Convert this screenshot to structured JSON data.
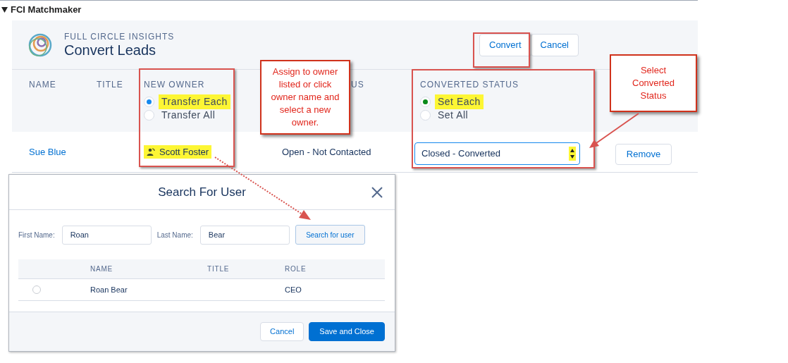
{
  "section": {
    "title": "FCI Matchmaker",
    "expanded": true
  },
  "app": {
    "brand": "FULL CIRCLE INSIGHTS",
    "title": "Convert Leads",
    "buttons": [
      {
        "label": "Convert",
        "kind": "neutral"
      },
      {
        "label": "Cancel",
        "kind": "neutral"
      }
    ]
  },
  "columns": [
    {
      "label": "NAME"
    },
    {
      "label": "TITLE"
    },
    {
      "label": "NEW OWNER"
    },
    {
      "label": "US"
    },
    {
      "label": "CONVERTED STATUS"
    }
  ],
  "owner_options": [
    {
      "label": "Transfer Each",
      "selected": true,
      "highlighted": true
    },
    {
      "label": "Transfer All",
      "selected": false,
      "highlighted": false
    }
  ],
  "status_options": [
    {
      "label": "Set Each",
      "selected": true,
      "highlighted": true
    },
    {
      "label": "Set All",
      "selected": false,
      "highlighted": false
    }
  ],
  "rows": [
    {
      "name": "Sue Blue",
      "owner": "Scott Foster",
      "owner_highlighted": true,
      "status": "Open - Not Contacted",
      "converted_status": "Closed - Converted",
      "action": "Remove"
    }
  ],
  "modal": {
    "title": "Search For User",
    "fields": [
      {
        "label": "First Name:",
        "value": "Roan"
      },
      {
        "label": "Last Name:",
        "value": "Bear"
      }
    ],
    "search_button": "Search for user",
    "columns": [
      {
        "label": "NAME"
      },
      {
        "label": "TITLE"
      },
      {
        "label": "ROLE"
      }
    ],
    "rows": [
      {
        "name": "Roan Bear",
        "role": "CEO",
        "selected": false
      }
    ],
    "buttons": [
      {
        "label": "Cancel",
        "kind": "neutral"
      },
      {
        "label": "Save and Close",
        "kind": "brand"
      }
    ]
  },
  "annotations": [
    {
      "text": "Assign to owner listed or click owner name and select a new owner."
    },
    {
      "text": "Select Converted Status"
    }
  ]
}
